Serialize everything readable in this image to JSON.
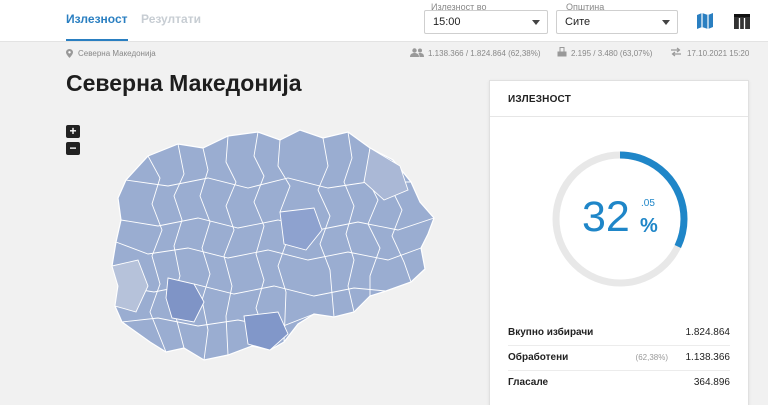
{
  "header": {
    "tabs": [
      {
        "label": "Излезност",
        "active": true
      },
      {
        "label": "Резултати",
        "active": false
      }
    ],
    "turnout_time": {
      "label": "Излезност во",
      "value": "15:00"
    },
    "municipality": {
      "label": "Општина",
      "value": "Сите"
    },
    "icons": [
      "map-icon",
      "table-icon"
    ]
  },
  "infobar": {
    "location": "Северна Македонија",
    "voters": "1.138.366 / 1.824.864 (62,38%)",
    "stations": "2.195 / 3.480 (63,07%)",
    "updated": "17.10.2021 15:20"
  },
  "page_title": "Северна Македонија",
  "map_controls": {
    "zoom_in": "+",
    "zoom_out": "−"
  },
  "card": {
    "title": "ИЗЛЕЗНОСТ",
    "gauge": {
      "integer": "32",
      "decimal": ".05",
      "unit": "%",
      "value_percent": 32.05
    },
    "rows": [
      {
        "label": "Вкупно избирачи",
        "pct": "",
        "value": "1.824.864"
      },
      {
        "label": "Обработени",
        "pct": "(62,38%)",
        "value": "1.138.366"
      },
      {
        "label": "Гласале",
        "pct": "",
        "value": "364.896"
      }
    ]
  },
  "colors": {
    "accent": "#2a7fc1",
    "gauge": "#1f86c8",
    "map_fill": "#8fa4cc"
  }
}
